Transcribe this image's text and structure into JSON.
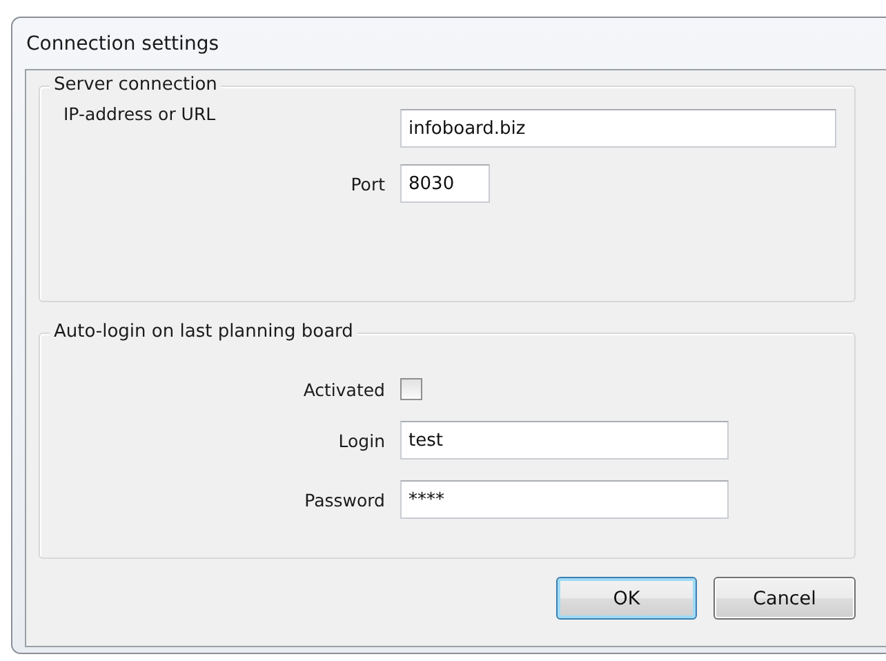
{
  "window": {
    "title": "Connection settings"
  },
  "server_group": {
    "title": "Server connection",
    "fields": [
      {
        "kind": "wide",
        "label": "IP-address or URL",
        "value": "infoboard.biz"
      },
      {
        "kind": "short",
        "label": "Port",
        "value": "8030"
      }
    ]
  },
  "autologin_group": {
    "title": "Auto-login on last planning board",
    "rows": [
      {
        "kind": "checkbox",
        "label": "Activated",
        "checked": false
      },
      {
        "kind": "text",
        "label": "Login",
        "value": "test"
      },
      {
        "kind": "text",
        "label": "Password",
        "value": "****"
      }
    ]
  },
  "buttons": [
    {
      "label": "OK",
      "default": true
    },
    {
      "label": "Cancel",
      "default": false
    }
  ]
}
